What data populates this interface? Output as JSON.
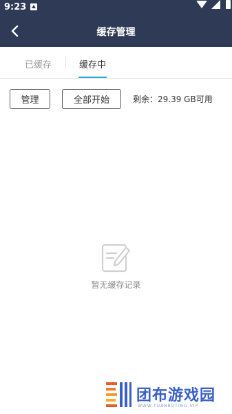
{
  "status_bar": {
    "time": "9:23",
    "icons": [
      "notification-icon",
      "wifi-icon",
      "signal-icon",
      "battery-icon"
    ]
  },
  "header": {
    "title": "缓存管理",
    "back_icon": "chevron-left-icon",
    "background": "#2f3a56"
  },
  "tabs": [
    {
      "label": "已缓存",
      "active": false
    },
    {
      "label": "缓存中",
      "active": true
    }
  ],
  "tab_indicator_color": "#2aa6d6",
  "toolbar": {
    "manage_label": "管理",
    "start_all_label": "全部开始",
    "storage_text": "剩余：29.39 GB可用"
  },
  "empty_state": {
    "icon": "edit-note-icon",
    "text": "暂无缓存记录"
  },
  "watermark": {
    "title": "团布游戏园",
    "subtitle": "WWW.TUANBUTING.VIP"
  }
}
